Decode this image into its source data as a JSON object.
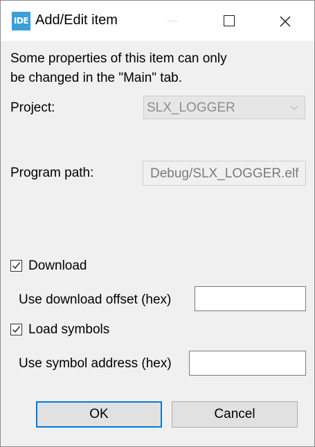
{
  "window": {
    "app_icon_text": "IDE",
    "title": "Add/Edit item",
    "icons": {
      "minimize": "minimize-icon",
      "maximize": "maximize-icon",
      "close": "close-icon",
      "dropdown": "chevron-down-icon",
      "check": "checkmark-icon"
    }
  },
  "info": {
    "line1": "Some properties of this item can only",
    "line2": "be changed in the \"Main\" tab."
  },
  "project": {
    "label": "Project:",
    "value": "SLX_LOGGER"
  },
  "program_path": {
    "label": "Program path:",
    "value": "Debug/SLX_LOGGER.elf"
  },
  "download": {
    "label": "Download",
    "checked": true,
    "offset_label": "Use download offset (hex)",
    "offset_value": ""
  },
  "load_symbols": {
    "label": "Load symbols",
    "checked": true,
    "address_label": "Use symbol address (hex)",
    "address_value": ""
  },
  "buttons": {
    "ok": "OK",
    "cancel": "Cancel"
  },
  "colors": {
    "accent": "#0078d7",
    "app_icon": "#3c9fd8",
    "dialog_bg": "#f0f0f0",
    "disabled_text": "#8d8d8d"
  }
}
